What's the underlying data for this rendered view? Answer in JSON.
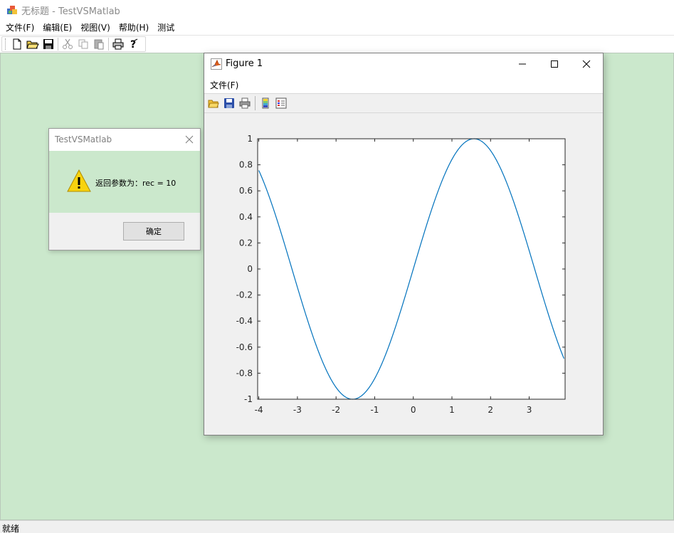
{
  "app": {
    "title": "无标题 - TestVSMatlab",
    "menu": [
      "文件(F)",
      "编辑(E)",
      "视图(V)",
      "帮助(H)",
      "测试"
    ],
    "toolbar_icons": [
      "new-file-icon",
      "open-folder-icon",
      "save-icon",
      "cut-icon",
      "copy-icon",
      "paste-icon",
      "print-icon",
      "help-icon"
    ],
    "status": "就绪",
    "client_bg": "#cbe8cc"
  },
  "message_box": {
    "title": "TestVSMatlab",
    "text": "返回参数为：rec = 10",
    "ok_label": "确定",
    "icon": "warning-icon"
  },
  "figure": {
    "title": "Figure 1",
    "menu": [
      "文件(F)"
    ],
    "toolbar_icons": [
      "open-icon",
      "save-icon",
      "print-icon",
      "colorbar-icon",
      "legend-icon"
    ]
  },
  "chart_data": {
    "type": "line",
    "title": "",
    "xlabel": "",
    "ylabel": "",
    "xlim": [
      -4,
      4
    ],
    "ylim": [
      -1,
      1
    ],
    "xticks": [
      -4,
      -3,
      -2,
      -1,
      0,
      1,
      2,
      3
    ],
    "yticks": [
      -1,
      -0.8,
      -0.6,
      -0.4,
      -0.2,
      0,
      0.2,
      0.4,
      0.6,
      0.8,
      1
    ],
    "grid": false,
    "line_color": "#0072bd",
    "series": [
      {
        "function": "sin(x)",
        "x": [
          -4,
          -3.5,
          -3,
          -2.5,
          -2,
          -1.5708,
          -1.5,
          -1,
          -0.5,
          0,
          0.5,
          1,
          1.5,
          1.5708,
          2,
          2.5,
          3,
          3.5,
          3.9
        ],
        "y": [
          0.757,
          0.351,
          -0.141,
          -0.598,
          -0.909,
          -1.0,
          -0.997,
          -0.841,
          -0.479,
          0,
          0.479,
          0.841,
          0.997,
          1.0,
          0.909,
          0.598,
          0.141,
          -0.351,
          -0.688
        ]
      }
    ]
  }
}
